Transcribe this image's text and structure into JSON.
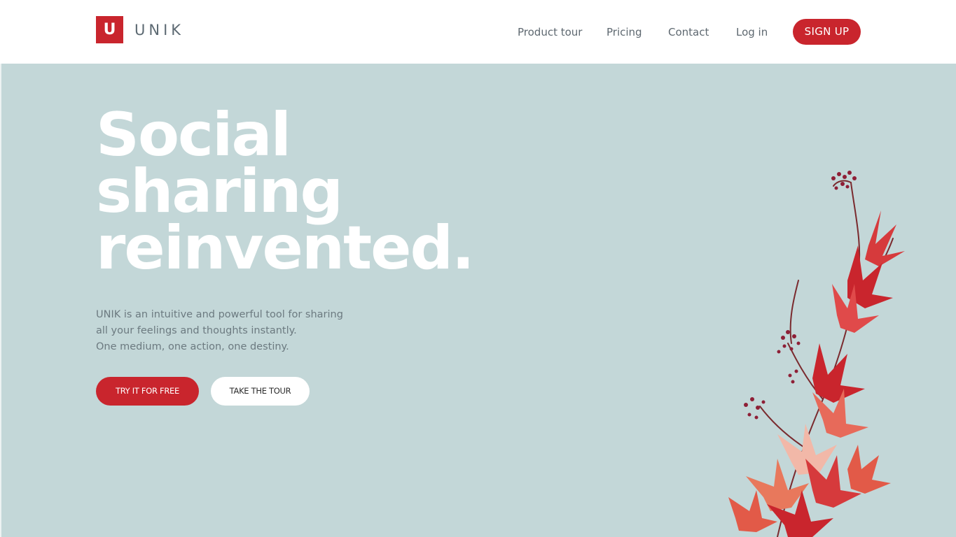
{
  "brand": {
    "logo_letter": "U",
    "name": "UNIK",
    "accent_color": "#c9252d"
  },
  "nav": {
    "items": [
      {
        "label": "Product tour"
      },
      {
        "label": "Pricing"
      },
      {
        "label": "Contact"
      },
      {
        "label": "Log in"
      }
    ],
    "signup_label": "SIGN UP"
  },
  "hero": {
    "background_color": "#c3d7d8",
    "headline": [
      "Social",
      "sharing",
      "reinvented."
    ],
    "description": [
      "UNIK is an intuitive and powerful tool for sharing",
      "all your feelings and thoughts instantly.",
      "One medium, one action, one destiny."
    ],
    "primary_cta": "TRY IT FOR FREE",
    "secondary_cta": "TAKE THE TOUR",
    "image": "red-autumn-leaves-branch-illustration"
  }
}
